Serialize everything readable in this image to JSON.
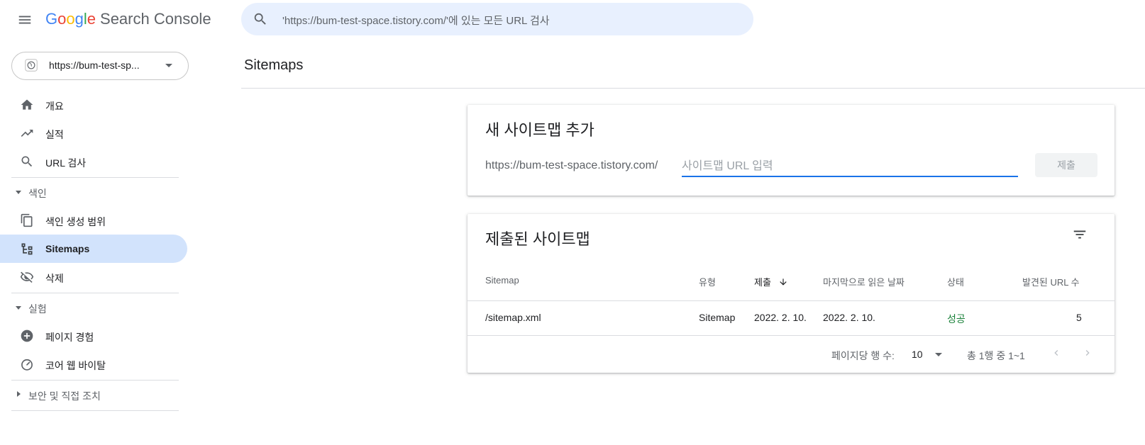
{
  "header": {
    "logo_google": [
      "G",
      "o",
      "o",
      "g",
      "l",
      "e"
    ],
    "logo_colors": [
      "#4285f4",
      "#ea4335",
      "#fbbc05",
      "#4285f4",
      "#34a853",
      "#ea4335"
    ],
    "logo_product": "Search Console",
    "search_placeholder": "'https://bum-test-space.tistory.com/'에 있는 모든 URL 검사"
  },
  "property": {
    "label": "https://bum-test-sp..."
  },
  "sidebar": {
    "items_top": [
      {
        "label": "개요",
        "icon": "home-icon"
      },
      {
        "label": "실적",
        "icon": "trending-up-icon"
      },
      {
        "label": "URL 검사",
        "icon": "search-icon"
      }
    ],
    "section_index": {
      "label": "색인",
      "items": [
        {
          "label": "색인 생성 범위",
          "icon": "copy-icon"
        },
        {
          "label": "Sitemaps",
          "icon": "sitemap-icon",
          "active": true
        },
        {
          "label": "삭제",
          "icon": "eye-off-icon"
        }
      ]
    },
    "section_experience": {
      "label": "실험",
      "items": [
        {
          "label": "페이지 경험",
          "icon": "plus-circle-icon"
        },
        {
          "label": "코어 웹 바이탈",
          "icon": "gauge-icon"
        }
      ]
    },
    "section_security": {
      "label": "보안 및 직접 조치"
    }
  },
  "main": {
    "page_title": "Sitemaps",
    "add_card": {
      "title": "새 사이트맵 추가",
      "url_prefix": "https://bum-test-space.tistory.com/",
      "input_placeholder": "사이트맵 URL 입력",
      "input_value": "",
      "submit_label": "제출"
    },
    "submitted_card": {
      "title": "제출된 사이트맵",
      "columns": [
        "Sitemap",
        "유형",
        "제출",
        "마지막으로 읽은 날짜",
        "상태",
        "발견된 URL 수"
      ],
      "sorted_column": "제출",
      "rows": [
        {
          "sitemap": "/sitemap.xml",
          "type": "Sitemap",
          "submitted": "2022. 2. 10.",
          "last_read": "2022. 2. 10.",
          "status": "성공",
          "urls": "5"
        }
      ],
      "pagination": {
        "rows_per_page_label": "페이지당 행 수:",
        "rows_per_page": "10",
        "range": "총 1행 중 1~1"
      }
    }
  },
  "colors": {
    "accent": "#1a73e8",
    "active_nav": "#d2e3fc",
    "success": "#188038",
    "search_bg": "#e8f0fe"
  }
}
